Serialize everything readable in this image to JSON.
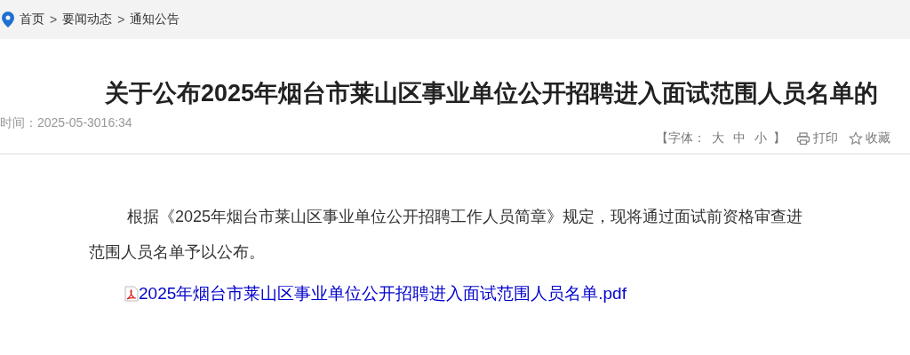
{
  "breadcrumb": [
    "首页",
    "要闻动态",
    "通知公告"
  ],
  "breadcrumb_separator": ">",
  "title": "关于公布2025年烟台市莱山区事业单位公开招聘进入面试范围人员名单的",
  "time": "时间：2025-05-3016:34",
  "font_size": {
    "label": "【字体：",
    "options": [
      "大",
      "中",
      "小"
    ],
    "end": "】"
  },
  "print": "打印",
  "favorite": "收藏",
  "paragraph_lines": [
    "根据《2025年烟台市莱山区事业单位公开招聘工作人员简章》规定，现将通过面试前资格审查进",
    "范围人员名单予以公布。"
  ],
  "attachment": "2025年烟台市莱山区事业单位公开招聘进入面试范围人员名单.pdf"
}
